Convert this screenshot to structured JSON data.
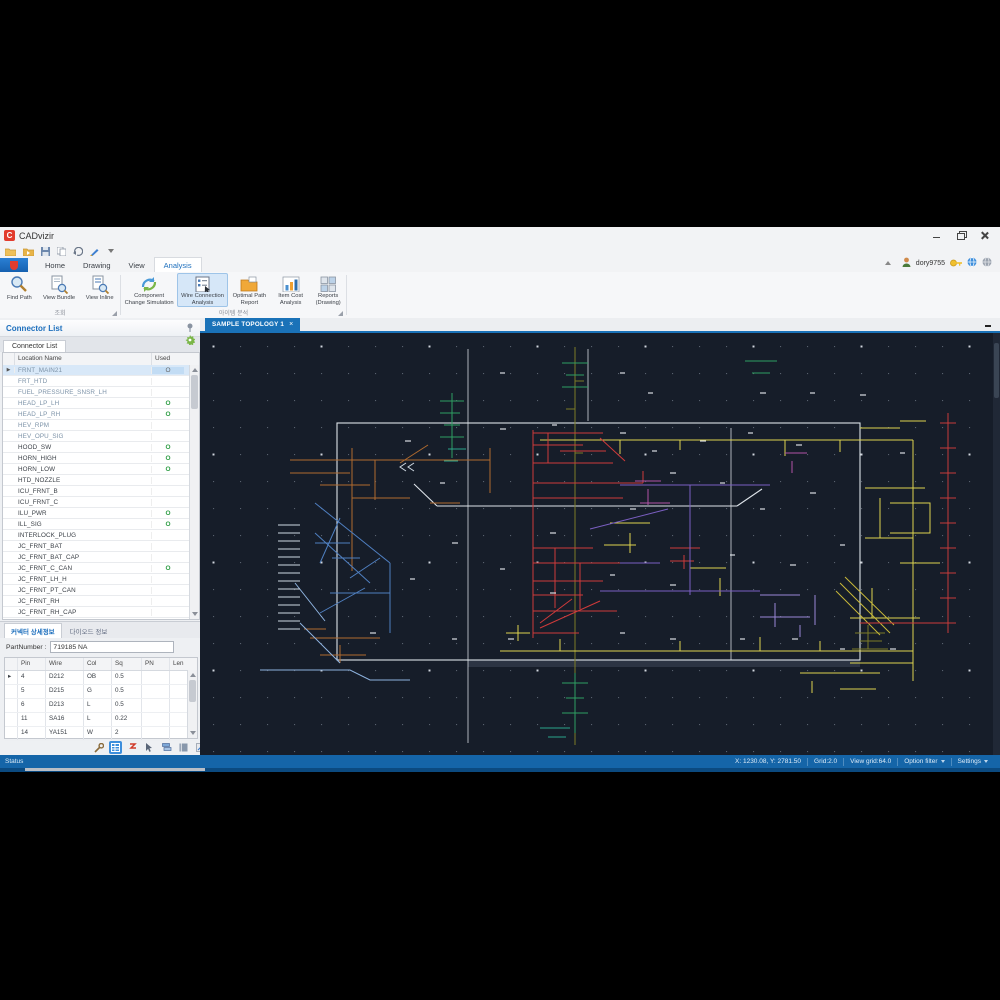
{
  "app": {
    "title": "CADvizir"
  },
  "colors": {
    "accent_blue": "#1a72b8",
    "status_bar": "#1565a8",
    "canvas_bg": "#161d29",
    "selection": "#d6e7f8",
    "wire_palette": [
      "#cf3a3a",
      "#ddd44e",
      "#7c7c26",
      "#b06a2e",
      "#4f7fc0",
      "#7b5fc2",
      "#2f9e62",
      "#b254a8",
      "#dde3e9"
    ]
  },
  "titlebar": {
    "minimize": "minimize",
    "restore": "restore",
    "close": "close"
  },
  "ribbon": {
    "tabs": [
      {
        "label": "Home"
      },
      {
        "label": "Drawing"
      },
      {
        "label": "View"
      },
      {
        "label": "Analysis",
        "active": true
      }
    ],
    "user": {
      "name": "dory9755"
    },
    "groups": [
      {
        "label": "조회",
        "buttons": [
          {
            "label": "Find Path"
          },
          {
            "label": "View Bundle"
          },
          {
            "label": "View Inline"
          }
        ]
      },
      {
        "label": "아이템 분석",
        "buttons": [
          {
            "label": "Component\nChange Simulation"
          },
          {
            "label": "Wire Connection\nAnalysis",
            "active": true
          },
          {
            "label": "Optimal Path\nReport"
          },
          {
            "label": "Item Cost\nAnalysis"
          },
          {
            "label": "Reports\n(Drawing)"
          }
        ]
      }
    ]
  },
  "connectorPanel": {
    "title": "Connector List",
    "tab": "Connector List",
    "columns": [
      "Location Name",
      "Used"
    ],
    "rows": [
      {
        "name": "FRNT_MAIN21",
        "used": "O",
        "selected": true,
        "muted": true
      },
      {
        "name": "FRT_HTD",
        "used": "",
        "muted": true
      },
      {
        "name": "FUEL_PRESSURE_SNSR_LH",
        "used": "",
        "muted": true
      },
      {
        "name": "HEAD_LP_LH",
        "used": "O",
        "muted": true
      },
      {
        "name": "HEAD_LP_RH",
        "used": "O",
        "muted": true
      },
      {
        "name": "HEV_RPM",
        "used": "",
        "muted": true
      },
      {
        "name": "HEV_OPU_SIG",
        "used": "",
        "muted": true
      },
      {
        "name": "HOOD_SW",
        "used": "O"
      },
      {
        "name": "HORN_HIGH",
        "used": "O"
      },
      {
        "name": "HORN_LOW",
        "used": "O"
      },
      {
        "name": "HTD_NOZZLE",
        "used": ""
      },
      {
        "name": "ICU_FRNT_B",
        "used": ""
      },
      {
        "name": "ICU_FRNT_C",
        "used": ""
      },
      {
        "name": "ILU_PWR",
        "used": "O"
      },
      {
        "name": "ILL_SIG",
        "used": "O"
      },
      {
        "name": "INTERLOCK_PLUG",
        "used": ""
      },
      {
        "name": "JC_FRNT_BAT",
        "used": ""
      },
      {
        "name": "JC_FRNT_BAT_CAP",
        "used": ""
      },
      {
        "name": "JC_FRNT_C_CAN",
        "used": "O"
      },
      {
        "name": "JC_FRNT_LH_H",
        "used": ""
      },
      {
        "name": "JC_FRNT_PT_CAN",
        "used": ""
      },
      {
        "name": "JC_FRNT_RH",
        "used": ""
      },
      {
        "name": "JC_FRNT_RH_CAP",
        "used": ""
      }
    ],
    "detailTabs": [
      {
        "label": "커넥터 상세정보",
        "active": true
      },
      {
        "label": "다이오드 정보"
      }
    ],
    "partNumberLabel": "PartNumber :",
    "partNumber": "719185 NA",
    "pinColumns": [
      "Pin",
      "Wire",
      "Col",
      "Sq",
      "PN",
      "Len"
    ],
    "pinRows": [
      [
        "4",
        "D212",
        "OB",
        "0.5",
        "",
        ""
      ],
      [
        "5",
        "D215",
        "G",
        "0.5",
        "",
        ""
      ],
      [
        "6",
        "D213",
        "L",
        "0.5",
        "",
        ""
      ],
      [
        "11",
        "SA16",
        "L",
        "0.22",
        "",
        ""
      ],
      [
        "14",
        "YA151",
        "W",
        "2",
        "",
        ""
      ]
    ]
  },
  "document": {
    "tabLabel": "SAMPLE TOPOLOGY 1",
    "closeGlyph": "×"
  },
  "statusbar": {
    "left": "Status",
    "position": "X: 1230.08, Y: 2781.50",
    "grid": "Grid:2.0",
    "viewGrid": "View grid:64.0",
    "optionFilter": "Option filter",
    "settings": "Settings"
  }
}
